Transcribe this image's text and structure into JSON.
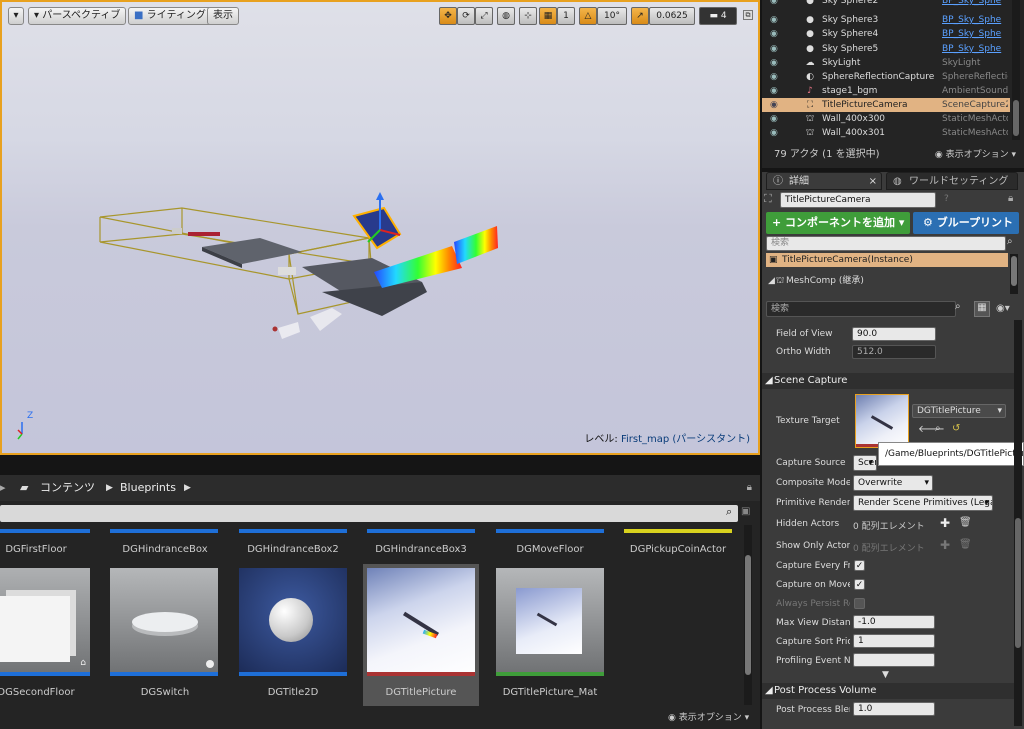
{
  "viewport": {
    "perspective_label": "パースペクティブ",
    "lighting_label": "ライティング",
    "show_label": "表示",
    "grid_snap": "1",
    "angle_snap": "10°",
    "scale_snap": "0.0625",
    "camera_speed": "4",
    "level_prefix": "レベル:",
    "level_name": "First_map (パーシスタント)"
  },
  "outliner": {
    "rows": [
      {
        "name": "Sky Sphere2",
        "type": "BP_Sky_Sphe",
        "link": true
      },
      {
        "name": "Sky Sphere3",
        "type": "BP_Sky_Sphe",
        "link": true
      },
      {
        "name": "Sky Sphere4",
        "type": "BP_Sky_Sphe",
        "link": true
      },
      {
        "name": "Sky Sphere5",
        "type": "BP_Sky_Sphe",
        "link": true
      },
      {
        "name": "SkyLight",
        "type": "SkyLight",
        "link": false
      },
      {
        "name": "SphereReflectionCapture",
        "type": "SphereReflectio",
        "link": false
      },
      {
        "name": "stage1_bgm",
        "type": "AmbientSound",
        "link": false
      },
      {
        "name": "TitlePictureCamera",
        "type": "SceneCapture2",
        "link": false
      },
      {
        "name": "Wall_400x300",
        "type": "StaticMeshActo",
        "link": false
      },
      {
        "name": "Wall_400x301",
        "type": "StaticMeshActo",
        "link": false
      }
    ],
    "footer_count": "79 アクタ (1 を選択中)",
    "view_options": "表示オプション"
  },
  "details": {
    "tab_details": "詳細",
    "tab_world": "ワールドセッティング",
    "actor_name": "TitlePictureCamera",
    "add_component": "+ コンポーネントを追加",
    "blueprint": "ブループリント",
    "search_placeholder": "検索",
    "instance_label": "TitlePictureCamera(Instance)",
    "meshcomp_label": "MeshComp (継承)",
    "field_of_view_label": "Field of View",
    "field_of_view": "90.0",
    "ortho_width_label": "Ortho Width",
    "ortho_width": "512.0",
    "scene_capture_header": "Scene Capture",
    "texture_target_label": "Texture Target",
    "texture_target": "DGTitlePicture",
    "tooltip": "/Game/Blueprints/DGTitlePicture",
    "capture_source_label": "Capture Source",
    "capture_source": "Scen",
    "composite_mode_label": "Composite Mode",
    "composite_mode": "Overwrite",
    "primitive_render_label": "Primitive Render M",
    "primitive_render": "Render Scene Primitives (Lega",
    "hidden_actors_label": "Hidden Actors",
    "hidden_actors": "0 配列エレメント",
    "show_only_label": "Show Only Actors",
    "show_only": "0 配列エレメント",
    "capture_every_frame_label": "Capture Every Fran",
    "capture_on_move_label": "Capture on Movem",
    "always_persist_label": "Always Persist Rer",
    "max_view_distance_label": "Max View Distance",
    "max_view_distance": "-1.0",
    "capture_sort_label": "Capture Sort Priori",
    "capture_sort": "1",
    "profiling_label": "Profiling Event Nar",
    "profiling": "",
    "post_process_header": "Post Process Volume",
    "post_process_blend_label": "Post Process Blen",
    "post_process_blend": "1.0"
  },
  "content": {
    "breadcrumb_root": "コンテンツ",
    "breadcrumb_folder": "Blueprints",
    "view_options": "表示オプション",
    "top_row": [
      "DGFirstFloor",
      "DGHindranceBox",
      "DGHindranceBox2",
      "DGHindranceBox3",
      "DGMoveFloor",
      "DGPickupCoinActor"
    ],
    "bottom_row": [
      "DGSecondFloor",
      "DGSwitch",
      "DGTitle2D",
      "DGTitlePicture",
      "DGTitlePicture_Mat"
    ]
  },
  "colors": {
    "accent": "#e8a11f",
    "selection": "#e1b383",
    "add_button": "#3f9d3a",
    "blueprint_button": "#2b6fb3",
    "link": "#5aa0ff"
  }
}
